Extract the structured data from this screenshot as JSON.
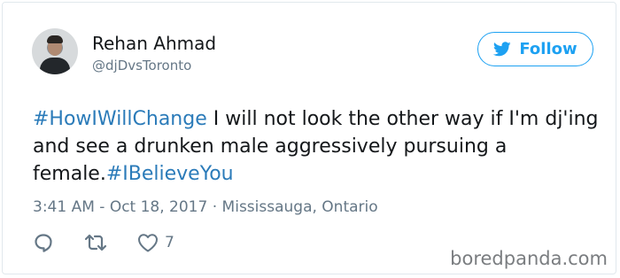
{
  "author": {
    "display_name": "Rehan Ahmad",
    "handle": "@djDvsToronto"
  },
  "follow_button": {
    "label": "Follow",
    "icon": "twitter-bird-icon"
  },
  "tweet": {
    "hashtag_1": "#HowIWillChange",
    "text_1": " I will not look the other way if I'm dj'ing and see a drunken male aggressively pursuing a female.",
    "hashtag_2": "#IBelieveYou"
  },
  "meta": {
    "timestamp": "3:41 AM - Oct 18, 2017",
    "separator": " · ",
    "location": "Mississauga, Ontario"
  },
  "actions": {
    "reply_icon": "reply-icon",
    "retweet_icon": "retweet-icon",
    "like_icon": "heart-icon",
    "like_count": "7"
  },
  "watermark": "boredpanda.com",
  "colors": {
    "accent": "#1da1f2",
    "hashtag": "#2b7bb9",
    "secondary_text": "#657786",
    "border": "#e1e8ed"
  }
}
